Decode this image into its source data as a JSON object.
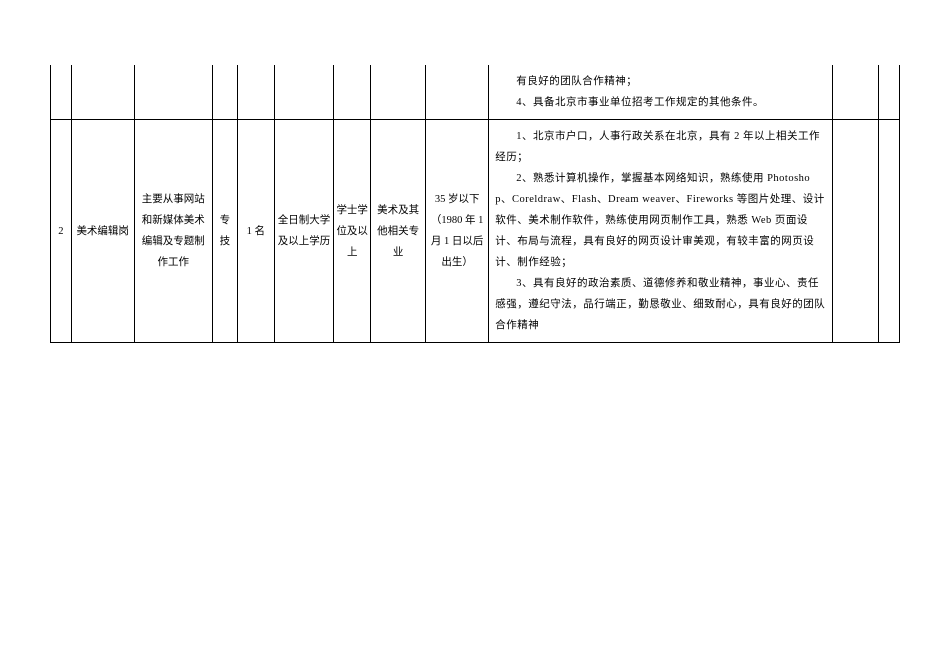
{
  "rows": [
    {
      "index": "",
      "position": "",
      "duty": "",
      "category": "",
      "count": "",
      "education": "",
      "degree": "",
      "major": "",
      "age": "",
      "requirements": [
        "有良好的团队合作精神；",
        "4、具备北京市事业单位招考工作规定的其他条件。"
      ],
      "note1": "",
      "note2": ""
    },
    {
      "index": "2",
      "position": "美术编辑岗",
      "duty": "主要从事网站和新媒体美术编辑及专题制作工作",
      "category": "专技",
      "count": "1 名",
      "education": "全日制大学及以上学历",
      "degree": "学士学位及以上",
      "major": "美术及其他相关专业",
      "age": "35 岁以下（1980 年 1 月 1 日以后出生）",
      "requirements": [
        "1、北京市户口，人事行政关系在北京，具有 2 年以上相关工作经历；",
        "2、熟悉计算机操作，掌握基本网络知识，熟练使用 Photoshop、Coreldraw、Flash、Dream weaver、Fireworks 等图片处理、设计软件、美术制作软件，熟练使用网页制作工具，熟悉 Web 页面设计、布局与流程，具有良好的网页设计审美观，有较丰富的网页设计、制作经验；",
        "3、具有良好的政治素质、道德修养和敬业精神，事业心、责任感强，遵纪守法，品行端正，勤恳敬业、细致耐心，具有良好的团队合作精神"
      ],
      "note1": "",
      "note2": ""
    }
  ]
}
